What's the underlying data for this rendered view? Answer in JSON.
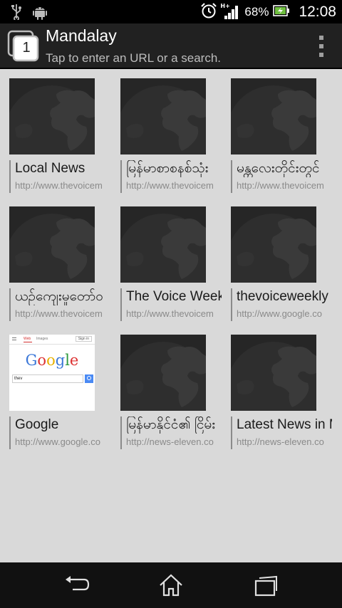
{
  "status_bar": {
    "battery_percent": "68%",
    "time": "12:08",
    "network_type": "H+",
    "icons": [
      "usb-icon",
      "android-debug-icon",
      "alarm-icon",
      "signal-icon",
      "battery-icon"
    ]
  },
  "title_bar": {
    "tab_count": "1",
    "title": "Mandalay",
    "url_hint": "Tap to enter an URL or a search."
  },
  "bookmarks": [
    {
      "title": "Local News",
      "url": "http://www.thevoicem"
    },
    {
      "title": "မြန်မာစာစနစ်သုံး",
      "url": "http://www.thevoicem"
    },
    {
      "title": "မန္တလေးတိုင်းတွင်",
      "url": "http://www.thevoicem"
    },
    {
      "title": "ယဉ်ကျေးမှုတော်ဝ",
      "url": "http://www.thevoicem"
    },
    {
      "title": "The Voice Week",
      "url": "http://www.thevoicem"
    },
    {
      "title": "thevoiceweekly",
      "url": "http://www.google.co"
    },
    {
      "title": "Google",
      "url": "http://www.google.co"
    },
    {
      "title": "မြန်မာနိုင်ငံ၏ ငြိမ်း",
      "url": "http://news-eleven.co"
    },
    {
      "title": "Latest News in M",
      "url": "http://news-eleven.co"
    }
  ],
  "google_thumb": {
    "tab_web": "Web",
    "tab_images": "Images",
    "sign_in": "Sign in",
    "logo_letters": [
      "G",
      "o",
      "o",
      "g",
      "l",
      "e"
    ],
    "query": "thev"
  },
  "colors": {
    "status_bar_bg": "#000000",
    "title_bar_bg": "#212121",
    "grid_bg": "#d9d9d9",
    "thumb_bg": "#262626",
    "nav_bar_bg": "#111111"
  }
}
